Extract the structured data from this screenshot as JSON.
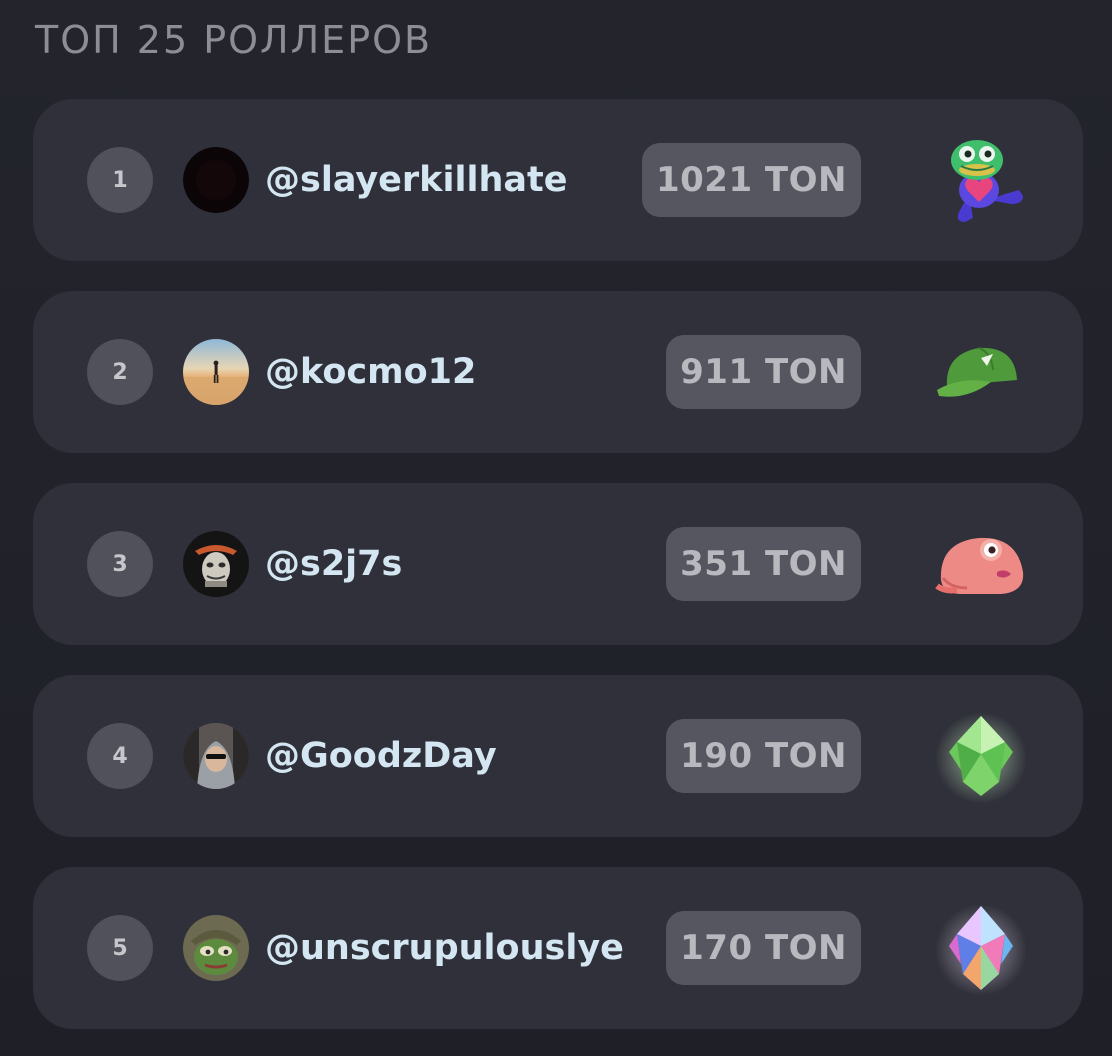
{
  "leaderboard": {
    "title": "ТОП 25 РОЛЛЕРОВ",
    "entries": [
      {
        "rank": "1",
        "username": "@slayerkillhate",
        "amount": "1021 TON",
        "avatar": "dark-avatar",
        "prize": "pepe-heart-sticker-icon"
      },
      {
        "rank": "2",
        "username": "@kocmo12",
        "amount": "911 TON",
        "avatar": "beach-walker-avatar",
        "prize": "green-cap-icon"
      },
      {
        "rank": "3",
        "username": "@s2j7s",
        "amount": "351 TON",
        "avatar": "masked-figure-avatar",
        "prize": "pink-toad-icon"
      },
      {
        "rank": "4",
        "username": "@GoodzDay",
        "amount": "190 TON",
        "avatar": "hooded-man-avatar",
        "prize": "green-crystal-icon"
      },
      {
        "rank": "5",
        "username": "@unscrupulouslye",
        "amount": "170 TON",
        "avatar": "pepe-soldier-avatar",
        "prize": "rainbow-crystal-icon"
      }
    ]
  },
  "colors": {
    "background": "#22232b",
    "card": "#2f3039",
    "rank_badge": "#50515a",
    "amount_pill": "#555660",
    "username": "#d4e6f2",
    "title": "#8d8e95"
  }
}
